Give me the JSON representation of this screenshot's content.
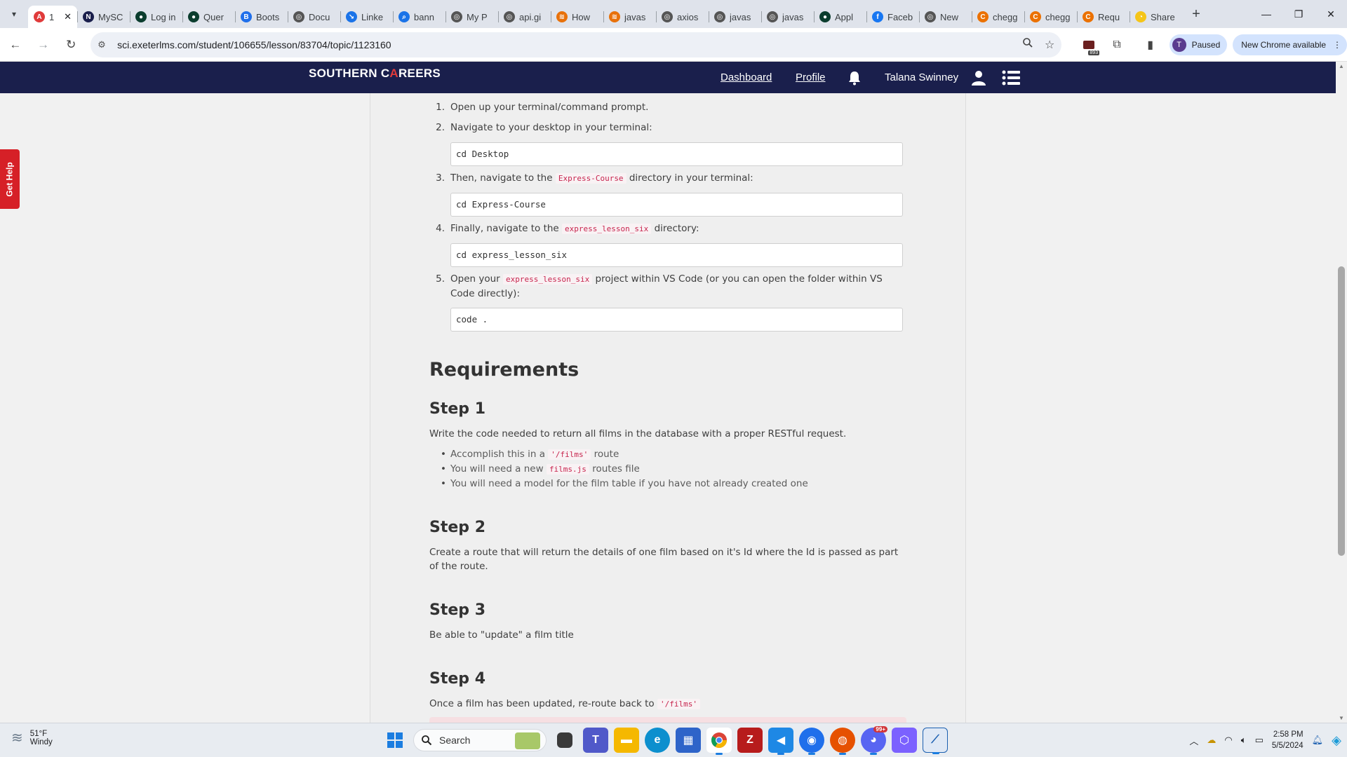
{
  "browser": {
    "tabs": [
      {
        "title": "1",
        "favicon_color": "#e03a3a",
        "favicon_glyph": "A",
        "active": true
      },
      {
        "title": "MySC",
        "favicon_color": "#1a1f4c",
        "favicon_glyph": "N"
      },
      {
        "title": "Log in",
        "favicon_color": "#0b3d2e",
        "favicon_glyph": "●"
      },
      {
        "title": "Quer",
        "favicon_color": "#0b3d2e",
        "favicon_glyph": "●"
      },
      {
        "title": "Boots",
        "favicon_color": "#1f6feb",
        "favicon_glyph": "B"
      },
      {
        "title": "Docu",
        "favicon_color": "#555555",
        "favicon_glyph": "◎"
      },
      {
        "title": "Linke",
        "favicon_color": "#1a73e8",
        "favicon_glyph": "↘"
      },
      {
        "title": "bann",
        "favicon_color": "#1a73e8",
        "favicon_glyph": "⌕"
      },
      {
        "title": "My P",
        "favicon_color": "#555555",
        "favicon_glyph": "◎"
      },
      {
        "title": "api.gi",
        "favicon_color": "#555555",
        "favicon_glyph": "◎"
      },
      {
        "title": "How",
        "favicon_color": "#e8710a",
        "favicon_glyph": "≋"
      },
      {
        "title": "javas",
        "favicon_color": "#e8710a",
        "favicon_glyph": "≋"
      },
      {
        "title": "axios",
        "favicon_color": "#555555",
        "favicon_glyph": "◎"
      },
      {
        "title": "javas",
        "favicon_color": "#555555",
        "favicon_glyph": "◎"
      },
      {
        "title": "javas",
        "favicon_color": "#555555",
        "favicon_glyph": "◎"
      },
      {
        "title": "Appl",
        "favicon_color": "#0b3d2e",
        "favicon_glyph": "●"
      },
      {
        "title": "Faceb",
        "favicon_color": "#1877f2",
        "favicon_glyph": "f"
      },
      {
        "title": "New",
        "favicon_color": "#555555",
        "favicon_glyph": "◎"
      },
      {
        "title": "chegg",
        "favicon_color": "#eb7100",
        "favicon_glyph": "C"
      },
      {
        "title": "chegg",
        "favicon_color": "#eb7100",
        "favicon_glyph": "C"
      },
      {
        "title": "Requ",
        "favicon_color": "#eb7100",
        "favicon_glyph": "C"
      },
      {
        "title": "Share",
        "favicon_color": "#f5c518",
        "favicon_glyph": "◔"
      }
    ],
    "url": "sci.exeterlms.com/student/106655/lesson/83704/topic/1123160",
    "profile_initial": "T",
    "profile_status": "Paused",
    "update_label": "New Chrome available",
    "extension_badge": "893"
  },
  "site": {
    "logo_text_before": "SOUTHERN C",
    "logo_accent": "A",
    "logo_text_after": "REERS",
    "nav_dashboard": "Dashboard",
    "nav_profile": "Profile",
    "user_name": "Talana Swinney",
    "get_help": "Get Help"
  },
  "lesson": {
    "steps_list": [
      {
        "num": "1.",
        "text": "Open up your terminal/command prompt."
      },
      {
        "num": "2.",
        "text": "Navigate to your desktop in your terminal:",
        "code": "cd Desktop"
      },
      {
        "num": "3.",
        "before": "Then, navigate to the",
        "inline": "Express-Course",
        "after": "directory in your terminal:",
        "code": "cd Express-Course"
      },
      {
        "num": "4.",
        "before": "Finally, navigate to the",
        "inline": "express_lesson_six",
        "after": "directory:",
        "code": "cd express_lesson_six"
      },
      {
        "num": "5.",
        "before": "Open your",
        "inline": "express_lesson_six",
        "after": "project within VS Code (or you can open the folder within VS",
        "line2": "Code directly):",
        "code": "code ."
      }
    ],
    "requirements_heading": "Requirements",
    "step1": {
      "heading": "Step 1",
      "text": "Write the code needed to return all films in the database with a proper RESTful request.",
      "bullets": [
        {
          "before": "Accomplish this in a",
          "inline": "'/films'",
          "after": "route"
        },
        {
          "before": "You will need a new",
          "inline": "films.js",
          "after": "routes file"
        },
        {
          "before": "You will need a model for the film table if you have not already created one",
          "inline": "",
          "after": ""
        }
      ]
    },
    "step2": {
      "heading": "Step 2",
      "text": "Create a route that will return the details of one film based on it's Id where the Id is passed as part of the route."
    },
    "step3": {
      "heading": "Step 3",
      "text": "Be able to \"update\" a film title"
    },
    "step4": {
      "heading": "Step 4",
      "before": "Once a film has been updated, re-route back to",
      "inline": "'/films'"
    }
  },
  "taskbar": {
    "temperature": "51°F",
    "weather": "Windy",
    "search_placeholder": "Search",
    "time": "2:58 PM",
    "date": "5/5/2024",
    "discord_badge": "99+"
  }
}
